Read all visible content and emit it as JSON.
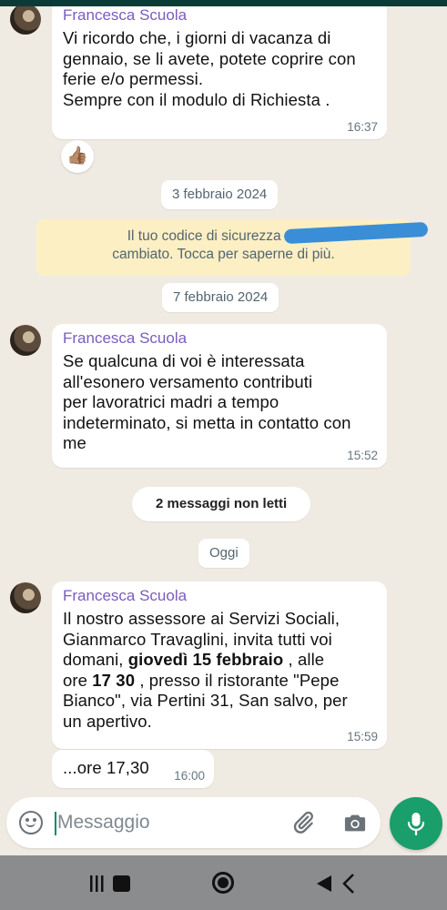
{
  "messages": [
    {
      "sender": "Francesca Scuola",
      "lines": [
        "Vi ricordo che, i giorni di vacanza di",
        "gennaio, se li avete, potete coprire con",
        "ferie e/o permessi.",
        "Sempre con il modulo di  Richiesta ."
      ],
      "time": "16:37",
      "reaction": "👍🏽"
    },
    {
      "sender": "Francesca Scuola",
      "lines": [
        "Se qualcuna di voi è interessata",
        "all'esonero versamento contributi",
        "per lavoratrici madri a tempo",
        "indeterminato, si metta in contatto con",
        "me"
      ],
      "time": "15:52"
    },
    {
      "sender": "Francesca Scuola",
      "line1": "Il nostro assessore ai Servizi Sociali,",
      "line2": "Gianmarco Travaglini, invita tutti voi",
      "line3_pre": "domani, ",
      "line3_bold": "giovedì 15 febbraio",
      "line3_post": " ,  alle",
      "line4_pre": "ore ",
      "line4_bold": "17 30",
      "line4_post": " , presso il ristorante \"Pepe",
      "line5": "Bianco\", via Pertini 31, San salvo, per",
      "line6": "un apertivo.",
      "time": "15:59"
    },
    {
      "text": "...ore 17,30",
      "time": "16:00"
    }
  ],
  "dates": {
    "d1": "3 febbraio 2024",
    "d2": "7 febbraio 2024",
    "today": "Oggi"
  },
  "security_notice": {
    "line1": "Il tuo codice di sicurezza con ~",
    "line2": "cambiato. Tocca per saperne di più."
  },
  "unread_label": "2 messaggi non letti",
  "composer": {
    "placeholder": "Messaggio",
    "emoji_icon": "emoji-icon",
    "attach_icon": "paperclip-icon",
    "camera_icon": "camera-icon",
    "mic_icon": "mic-icon"
  },
  "colors": {
    "background": "#efeae2",
    "sender": "#7b5bbd",
    "accent": "#1a9e6a",
    "notice": "#fcefc4"
  }
}
